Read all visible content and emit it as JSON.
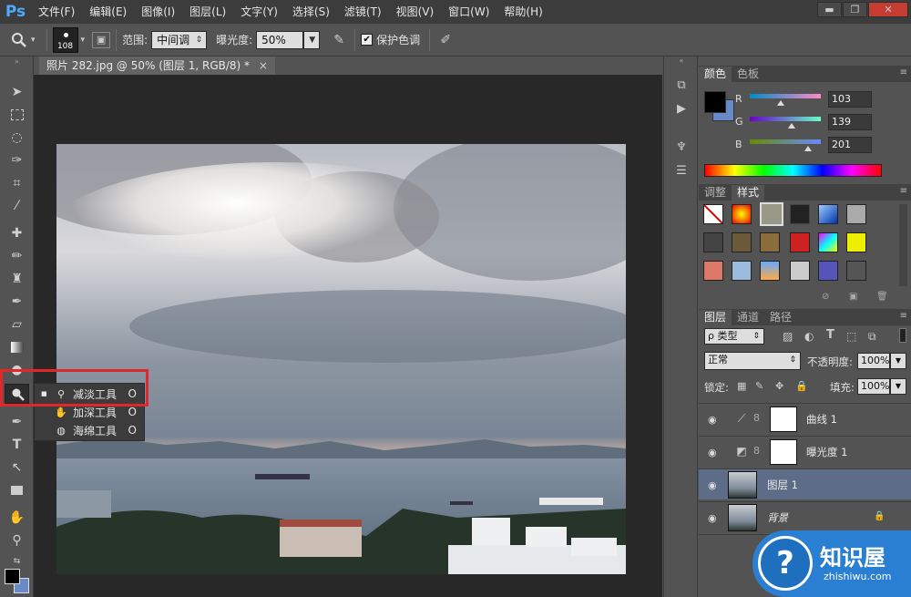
{
  "app": {
    "logo": "Ps"
  },
  "menu": [
    "文件(F)",
    "编辑(E)",
    "图像(I)",
    "图层(L)",
    "文字(Y)",
    "选择(S)",
    "滤镜(T)",
    "视图(V)",
    "窗口(W)",
    "帮助(H)"
  ],
  "window_controls": {
    "minimize": "▬",
    "restore": "❐",
    "close": "✕"
  },
  "options_bar": {
    "tool_icon": "sponge-magnifier-icon",
    "brush_size": "108",
    "range_label": "范围:",
    "range_value": "中间调",
    "exposure_label": "曝光度:",
    "exposure_value": "50%",
    "protect_tones_label": "保护色调",
    "protect_tones_checked": "✔"
  },
  "document": {
    "tab_title": "照片 282.jpg @ 50% (图层 1, RGB/8) *",
    "close": "×"
  },
  "flyout": {
    "items": [
      {
        "label": "减淡工具",
        "key": "O",
        "bullet": "■"
      },
      {
        "label": "加深工具",
        "key": "O",
        "bullet": ""
      },
      {
        "label": "海绵工具",
        "key": "O",
        "bullet": ""
      }
    ]
  },
  "color_panel": {
    "tabs": [
      "颜色",
      "色板"
    ],
    "r_label": "R",
    "g_label": "G",
    "b_label": "B",
    "r": "103",
    "g": "139",
    "b": "201",
    "foreground": "#000000",
    "background": "#678bc9"
  },
  "styles_panel": {
    "tabs": [
      "调整",
      "样式"
    ]
  },
  "layers_panel": {
    "tabs": [
      "图层",
      "通道",
      "路径"
    ],
    "filter_kind": "ρ 类型",
    "blend_mode": "正常",
    "opacity_label": "不透明度:",
    "opacity": "100%",
    "lock_label": "锁定:",
    "fill_label": "填充:",
    "fill": "100%",
    "layers": [
      {
        "name": "曲线 1",
        "type": "adjustment"
      },
      {
        "name": "曝光度 1",
        "type": "adjustment"
      },
      {
        "name": "图层 1",
        "type": "image",
        "selected": true
      },
      {
        "name": "背景",
        "type": "image",
        "locked": true
      }
    ]
  },
  "watermark": {
    "title": "知识屋",
    "subtitle": "zhishiwu.com"
  }
}
